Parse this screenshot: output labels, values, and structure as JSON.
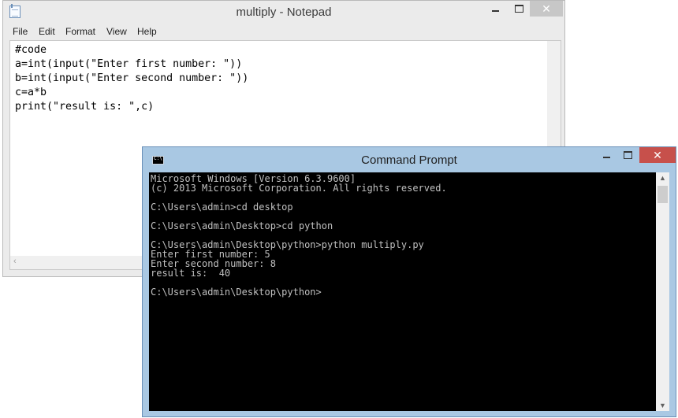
{
  "notepad": {
    "title": "multiply - Notepad",
    "menu": [
      "File",
      "Edit",
      "Format",
      "View",
      "Help"
    ],
    "lines": [
      "#code",
      "a=int(input(\"Enter first number: \"))",
      "b=int(input(\"Enter second number: \"))",
      "c=a*b",
      "print(\"result is: \",c)"
    ],
    "close_glyph": "✕",
    "scroll_left_glyph": "‹"
  },
  "cmd": {
    "title": "Command Prompt",
    "close_glyph": "✕",
    "scroll_up_glyph": "▲",
    "scroll_down_glyph": "▼",
    "lines": [
      "Microsoft Windows [Version 6.3.9600]",
      "(c) 2013 Microsoft Corporation. All rights reserved.",
      "",
      "C:\\Users\\admin>cd desktop",
      "",
      "C:\\Users\\admin\\Desktop>cd python",
      "",
      "C:\\Users\\admin\\Desktop\\python>python multiply.py",
      "Enter first number: 5",
      "Enter second number: 8",
      "result is:  40",
      "",
      "C:\\Users\\admin\\Desktop\\python>"
    ]
  },
  "colors": {
    "cmd_frame": "#a9c8e3",
    "cmd_close": "#c7504b",
    "terminal_bg": "#000000",
    "terminal_text": "#c0c0c0"
  }
}
